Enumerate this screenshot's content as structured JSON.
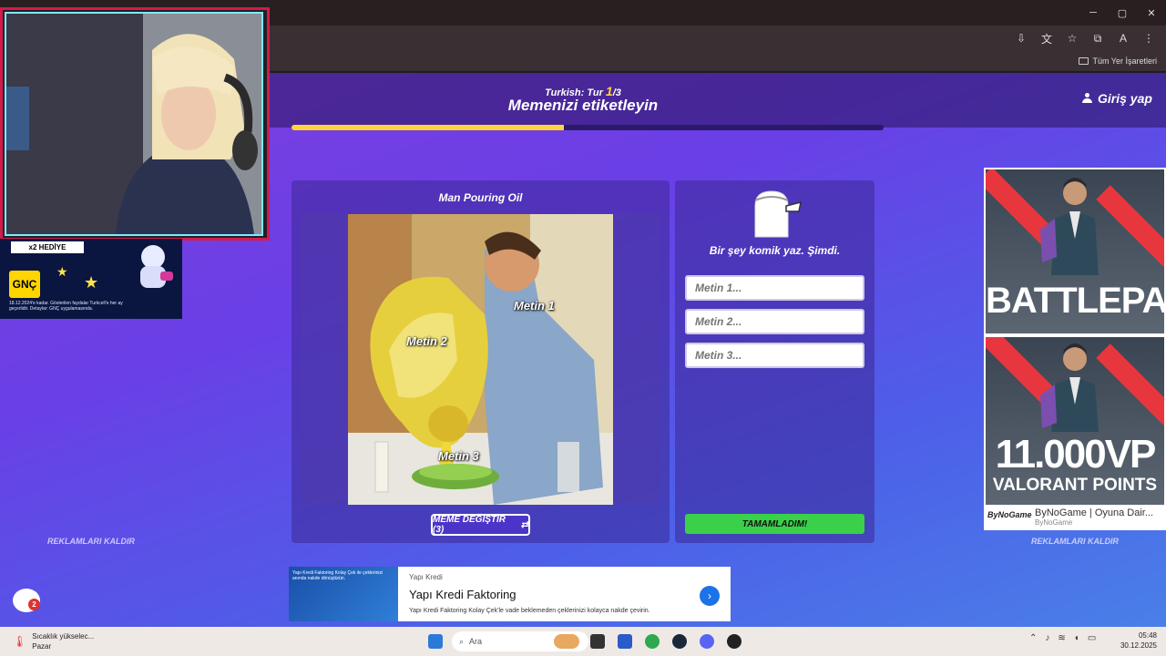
{
  "browser": {
    "window_controls": [
      "─",
      "▢",
      "✕"
    ],
    "bookmark_label": "Tüm Yer İşaretleri",
    "profile_initial": "A"
  },
  "header": {
    "round_prefix": "Turkish: Tur ",
    "round_current": "1",
    "round_total": "/3",
    "title": "Memenizi etiketleyin",
    "login_label": "Giriş yap",
    "progress_fraction": 0.46
  },
  "meme": {
    "name": "Man Pouring Oil",
    "labels": [
      "Metin 1",
      "Metin 2",
      "Metin 3"
    ],
    "change_button": "MEME DEĞİŞTİR (3)",
    "change_icon": "⇄"
  },
  "caption": {
    "hint": "Bir şey komik yaz. Şimdi.",
    "placeholders": [
      "Metin 1...",
      "Metin 2...",
      "Metin 3..."
    ],
    "done_button": "TAMAMLADIM!"
  },
  "remove_ads_label": "REKLAMLARI KALDIR",
  "right_ad": {
    "block1_text": "BATTLEPASS",
    "block2_big": "11.000VP",
    "block2_sub": "VALORANT POINTS",
    "footer_title": "ByNoGame | Oyuna Dair...",
    "footer_sub": "ByNoGame",
    "brand": "ByNoGame"
  },
  "bottom_ad": {
    "image_text": "Yapı Kredi Faktoring Kolay Çek ile çeklerinizi anında nakde dönüştürün.",
    "advertiser": "Yapı Kredi",
    "headline": "Yapı Kredi Faktoring",
    "description": "Yapı Kredi Faktoring Kolay Çek'le vade beklemeden çeklerinizi kolayca nakde çevirin."
  },
  "overlay": {
    "sponsor_badge": "x2 HEDİYE",
    "sponsor_logo": "GNÇ",
    "sponsor_note": "18.12.2024'e kadar. Gösterilen faydalar Turkcell'e her ay geçerlidir. Detaylar: GNÇ uygulamasında.",
    "chat_count": "2"
  },
  "taskbar": {
    "weather_line1": "Sıcaklık yükselec...",
    "weather_line2": "Pazar",
    "search_placeholder": "Ara",
    "time": "05:48",
    "date": "30.12.2025"
  }
}
